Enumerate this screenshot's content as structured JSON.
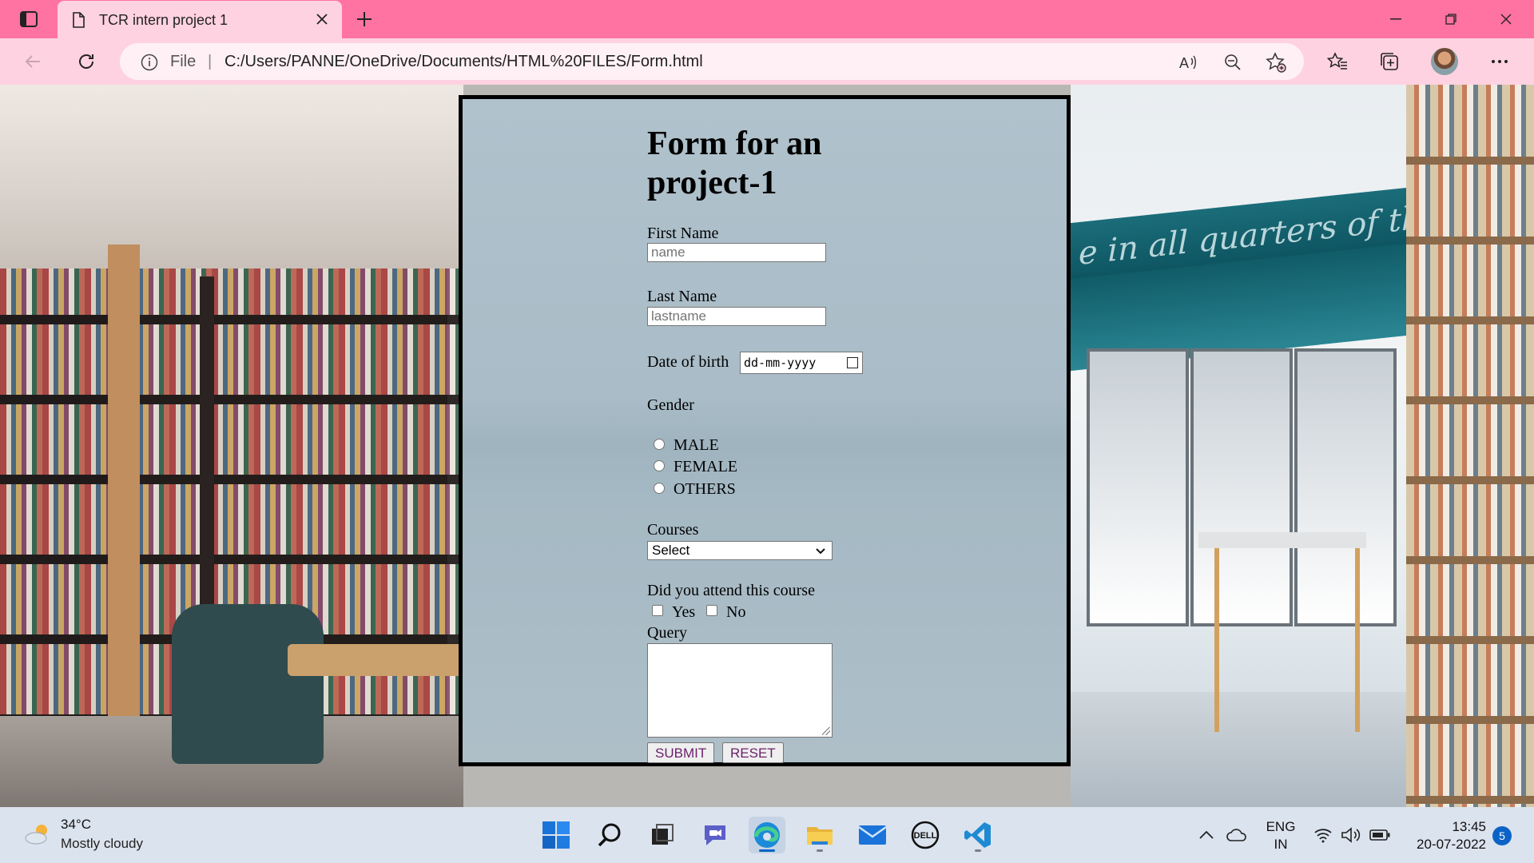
{
  "browser": {
    "tab_title": "TCR intern project 1",
    "address_scheme": "File",
    "address_separator": "|",
    "address_url": "C:/Users/PANNE/OneDrive/Documents/HTML%20FILES/Form.html",
    "accent_color": "#ff73a2",
    "toolbar_color": "#ffd2e1"
  },
  "form": {
    "title": "Form for an project-1",
    "first_name_label": "First Name",
    "first_name_placeholder": "name",
    "last_name_label": "Last Name",
    "last_name_placeholder": "lastname",
    "dob_label": "Date of birth",
    "dob_placeholder": "dd-mm-yyyy",
    "gender_label": "Gender",
    "gender_options": [
      "MALE",
      "FEMALE",
      "OTHERS"
    ],
    "courses_label": "Courses",
    "courses_selected": "Select",
    "attend_label": "Did you attend this course",
    "attend_options": [
      "Yes",
      "No"
    ],
    "query_label": "Query",
    "submit_label": "SUBMIT",
    "reset_label": "RESET"
  },
  "taskbar": {
    "weather_temp": "34°C",
    "weather_desc": "Mostly cloudy",
    "lang_primary": "ENG",
    "lang_secondary": "IN",
    "time": "13:45",
    "date": "20-07-2022",
    "notification_count": "5",
    "apps": [
      "start-icon",
      "search-icon",
      "task-view-icon",
      "chat-icon",
      "edge-icon",
      "file-explorer-icon",
      "mail-icon",
      "dell-icon",
      "vscode-icon"
    ]
  },
  "background": {
    "sign_text": "e in all quarters of the eart"
  }
}
